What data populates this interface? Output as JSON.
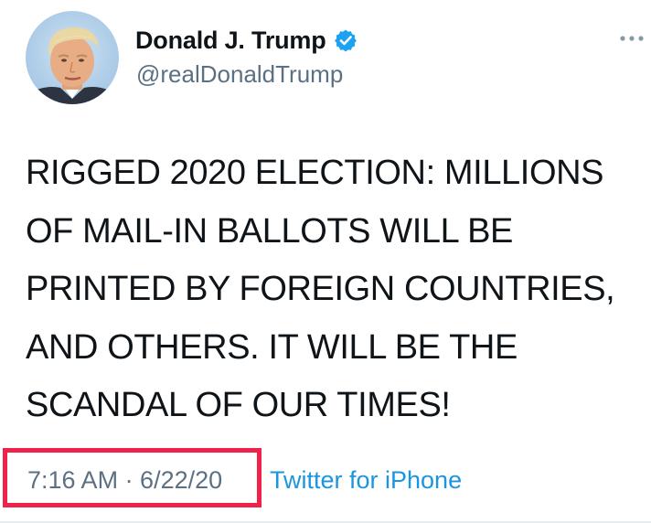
{
  "author": {
    "display_name": "Donald J. Trump",
    "handle": "@realDonaldTrump",
    "verified": true
  },
  "tweet": {
    "lines": [
      "RIGGED 2020 ELECTION: MILLIONS",
      "OF MAIL-IN BALLOTS WILL BE",
      "PRINTED BY FOREIGN COUNTRIES,",
      "AND OTHERS. IT WILL BE THE",
      "SCANDAL OF OUR TIMES!"
    ]
  },
  "meta": {
    "timestamp": "7:16 AM · 6/22/20",
    "source": "Twitter for iPhone"
  },
  "icons": {
    "verified": "verified-badge-icon",
    "more": "more-options-icon"
  },
  "colors": {
    "verified_blue": "#1da1f2",
    "link_blue": "#1b95e0",
    "muted_gray": "#5b7083",
    "highlight_red": "#f0224a"
  }
}
